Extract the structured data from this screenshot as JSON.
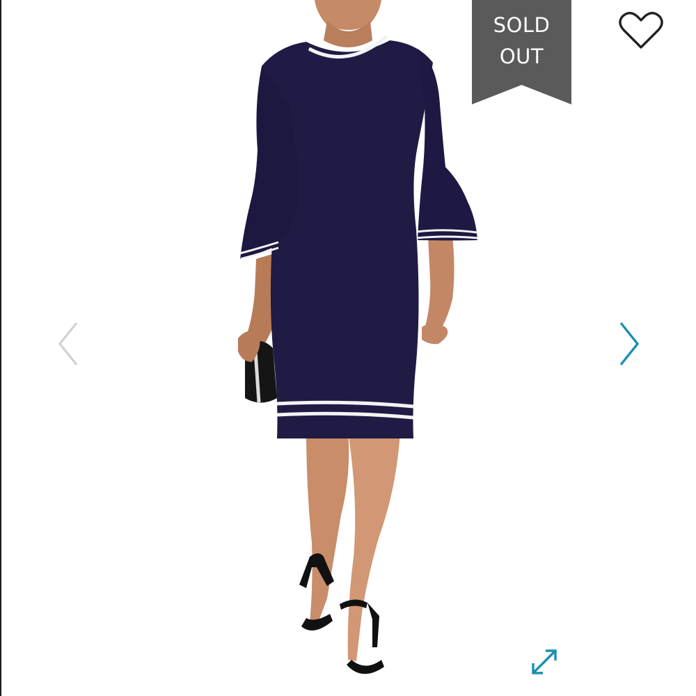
{
  "badge": {
    "status_line1": "SOLD",
    "status_line2": "OUT",
    "color": "#5a5a5a"
  },
  "icons": {
    "wishlist": "heart-icon",
    "previous": "chevron-left-icon",
    "next": "chevron-right-icon",
    "expand": "expand-arrows-icon"
  },
  "colors": {
    "dress": "#1f1b44",
    "stripe": "#f3f3f3",
    "skin": "#c98d69",
    "next_arrow": "#1a8fb0",
    "prev_arrow": "#cfcfcf",
    "expand_arrow": "#1a8fb0"
  }
}
